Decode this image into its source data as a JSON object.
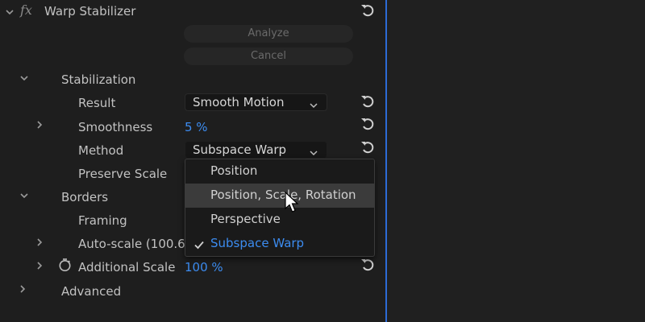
{
  "effect": {
    "fx": "fx",
    "title": "Warp Stabilizer"
  },
  "buttons": {
    "analyze": "Analyze",
    "cancel": "Cancel"
  },
  "stabilization": {
    "heading": "Stabilization",
    "result_label": "Result",
    "result_value": "Smooth Motion",
    "smoothness_label": "Smoothness",
    "smoothness_value": "5 %",
    "method_label": "Method",
    "method_value": "Subspace Warp",
    "preserve_label": "Preserve Scale"
  },
  "borders": {
    "heading": "Borders",
    "framing_label": "Framing",
    "autoscale_label": "Auto-scale (100.6%",
    "additional_scale_label": "Additional Scale",
    "additional_scale_value": "100 %"
  },
  "advanced": {
    "heading": "Advanced"
  },
  "method_menu": {
    "options": [
      "Position",
      "Position, Scale, Rotation",
      "Perspective",
      "Subspace Warp"
    ],
    "highlighted": "Position, Scale, Rotation",
    "selected": "Subspace Warp"
  },
  "colors": {
    "accent_blue": "#3c8cf0",
    "panel_divider": "#2d6bd6"
  }
}
